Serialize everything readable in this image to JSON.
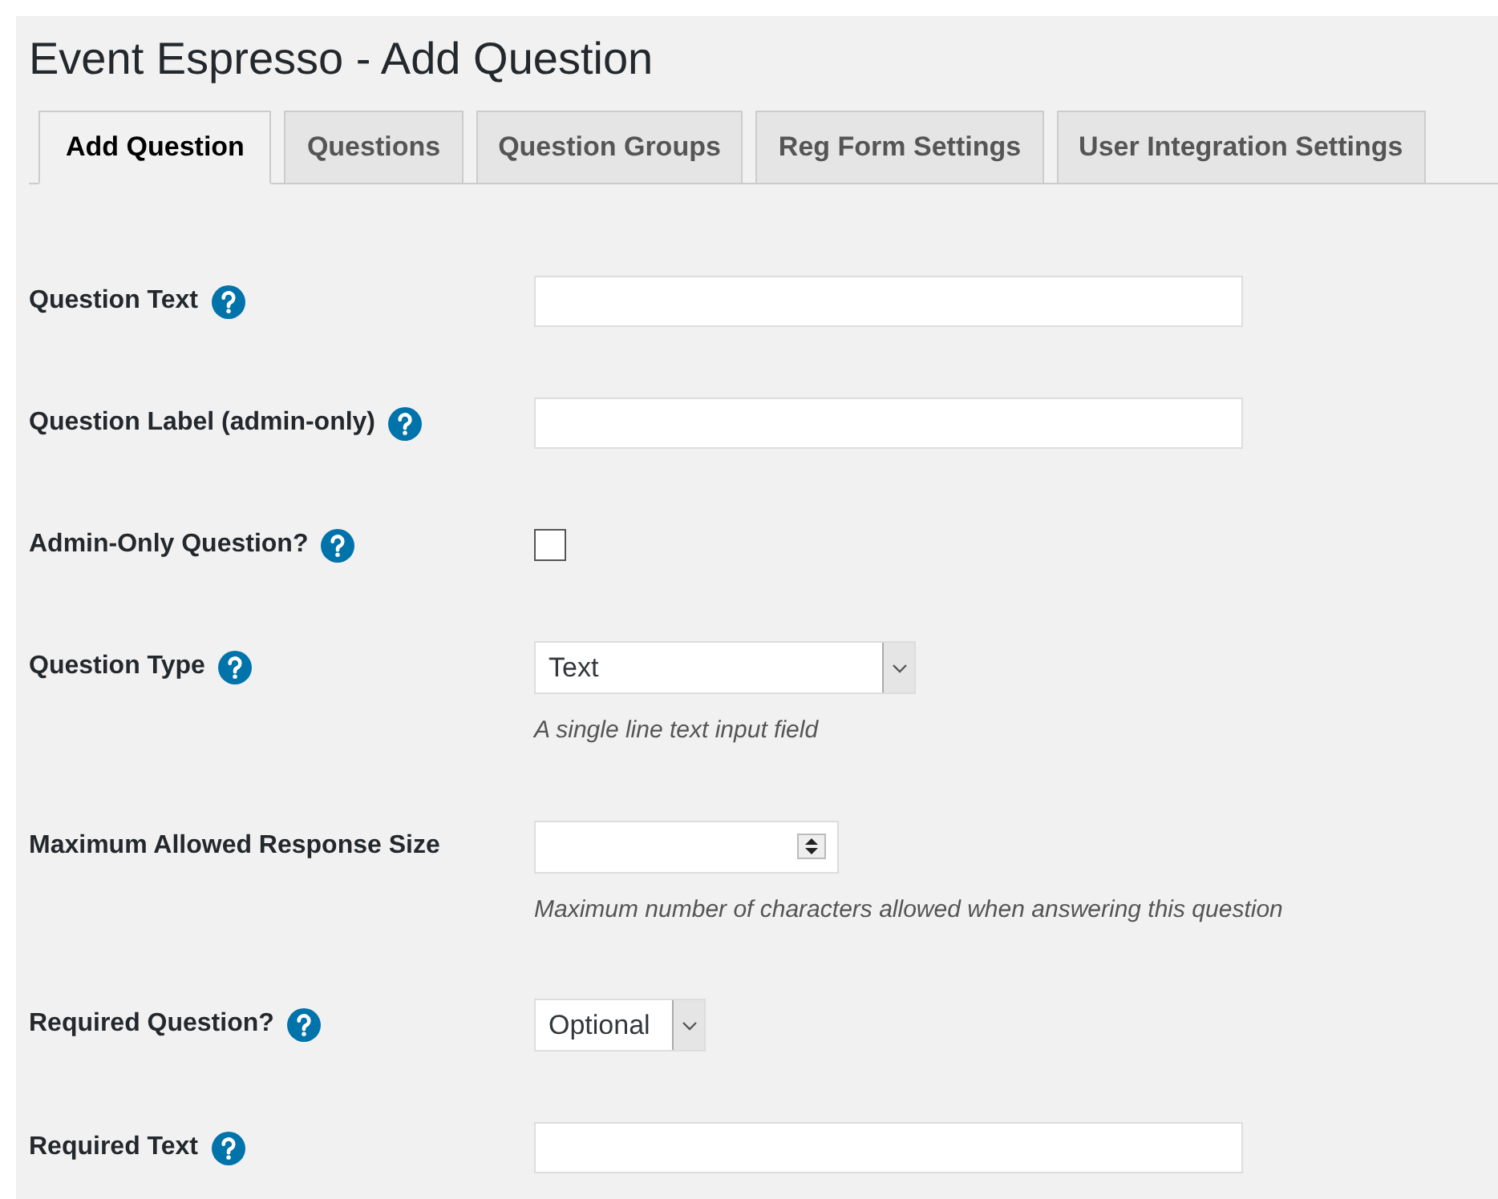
{
  "title": "Event Espresso - Add Question",
  "tabs": [
    {
      "label": "Add Question",
      "selected": true
    },
    {
      "label": "Questions",
      "selected": false
    },
    {
      "label": "Question Groups",
      "selected": false
    },
    {
      "label": "Reg Form Settings",
      "selected": false
    },
    {
      "label": "User Integration Settings",
      "selected": false
    }
  ],
  "fields": [
    {
      "kind": "text",
      "label": "Question Text",
      "help": true
    },
    {
      "kind": "text",
      "label": "Question Label (admin-only)",
      "help": true
    },
    {
      "kind": "checkbox",
      "label": "Admin-Only Question?",
      "help": true,
      "checked": false
    },
    {
      "kind": "select",
      "label": "Question Type",
      "help": true,
      "value": "Text",
      "description": "A single line text input field"
    },
    {
      "kind": "number",
      "label": "Maximum Allowed Response Size",
      "help": false,
      "description": "Maximum number of characters allowed when answering this question"
    },
    {
      "kind": "compact_select",
      "label": "Required Question?",
      "help": true,
      "value": "Optional"
    },
    {
      "kind": "text",
      "label": "Required Text",
      "help": true
    }
  ]
}
